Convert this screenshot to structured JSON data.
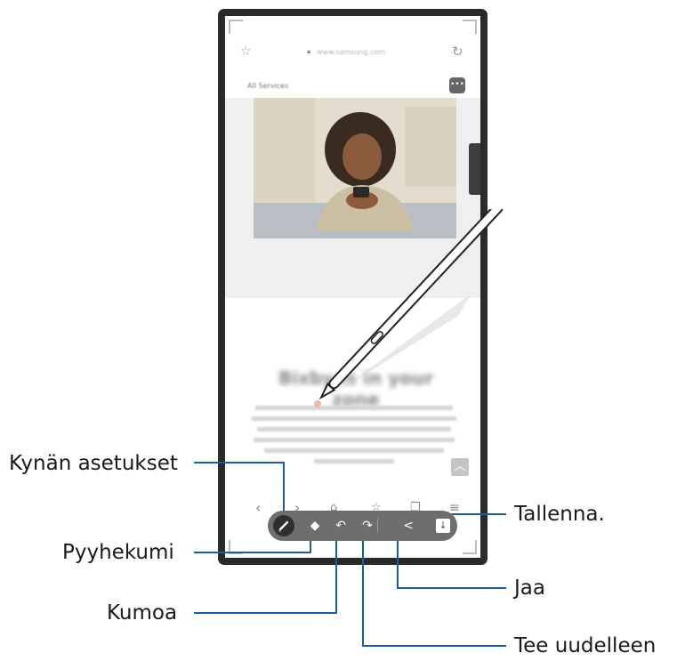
{
  "labels": {
    "pen_settings": "Kynän asetukset",
    "eraser": "Pyyhekumi",
    "undo": "Kumoa",
    "save": "Tallenna.",
    "share": "Jaa",
    "redo": "Tee uudelleen"
  },
  "screen": {
    "url": "www.samsung.com",
    "services": "All Services",
    "heading": "Bixby is in your zone"
  },
  "icons": {
    "bookmark": "star-outline-icon",
    "reload": "reload-icon",
    "chat": "chat-bubble-icon",
    "pen": "pen-icon",
    "eraser": "eraser-icon",
    "undo": "undo-icon",
    "redo": "redo-icon",
    "share": "share-icon",
    "save": "download-icon"
  },
  "colors": {
    "callout_line": "#1f5c99",
    "toolbar": "#6e6e6e",
    "phone_frame": "#2a2a2a"
  }
}
